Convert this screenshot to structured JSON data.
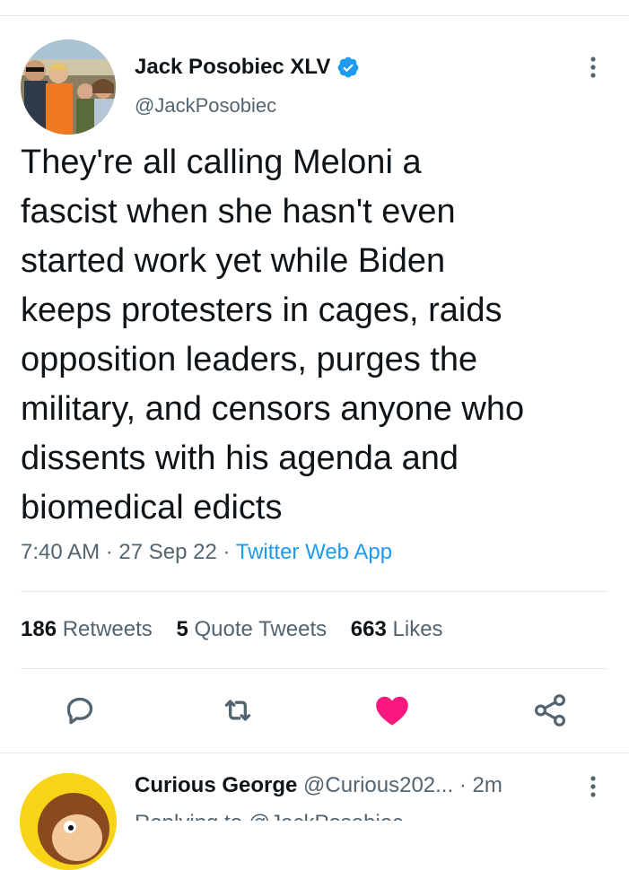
{
  "tweet": {
    "author_name": "Jack Posobiec XLV",
    "author_handle": "@JackPosobiec",
    "text": "They're all calling Meloni a\nfascist when she hasn't even\nstarted work yet while Biden\nkeeps protesters in cages, raids\nopposition leaders, purges the\nmilitary, and censors anyone who\ndissents with his agenda and\nbiomedical edicts",
    "time": "7:40 AM",
    "date": "27 Sep 22",
    "source": "Twitter Web App",
    "separator": "·",
    "stats": {
      "retweets_count": "186",
      "retweets_label": "Retweets",
      "quote_count": "5",
      "quote_label": "Quote Tweets",
      "likes_count": "663",
      "likes_label": "Likes"
    },
    "icons": {
      "verified": "verified-badge-icon",
      "reply": "reply-icon",
      "retweet": "retweet-icon",
      "like": "heart-icon",
      "share": "share-icon",
      "more": "more-icon"
    },
    "liked": true
  },
  "reply": {
    "author_name": "Curious George",
    "author_handle": "@Curious202...",
    "time": "· 2m",
    "partial_text": "Replying to @JackPosobiec"
  },
  "colors": {
    "text": "#0f1419",
    "secondary": "#536471",
    "accent": "#1d9bf0",
    "like": "#f91880",
    "divider": "#e7e9ea"
  }
}
